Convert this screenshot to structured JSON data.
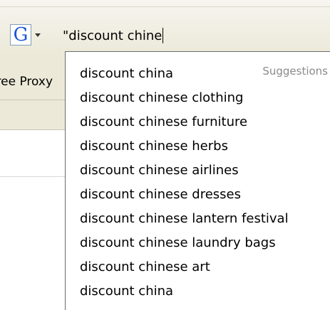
{
  "search": {
    "engine_icon": "google-g-icon",
    "engine_letter": "G",
    "query": "\"discount chine"
  },
  "background": {
    "proxy_label": "Free Proxy"
  },
  "autocomplete": {
    "header_label": "Suggestions",
    "suggestions": [
      "discount china",
      "discount chinese clothing",
      "discount chinese furniture",
      "discount chinese herbs",
      "discount chinese airlines",
      "discount chinese dresses",
      "discount chinese lantern festival",
      "discount chinese laundry bags",
      "discount chinese art",
      "discount china"
    ]
  }
}
